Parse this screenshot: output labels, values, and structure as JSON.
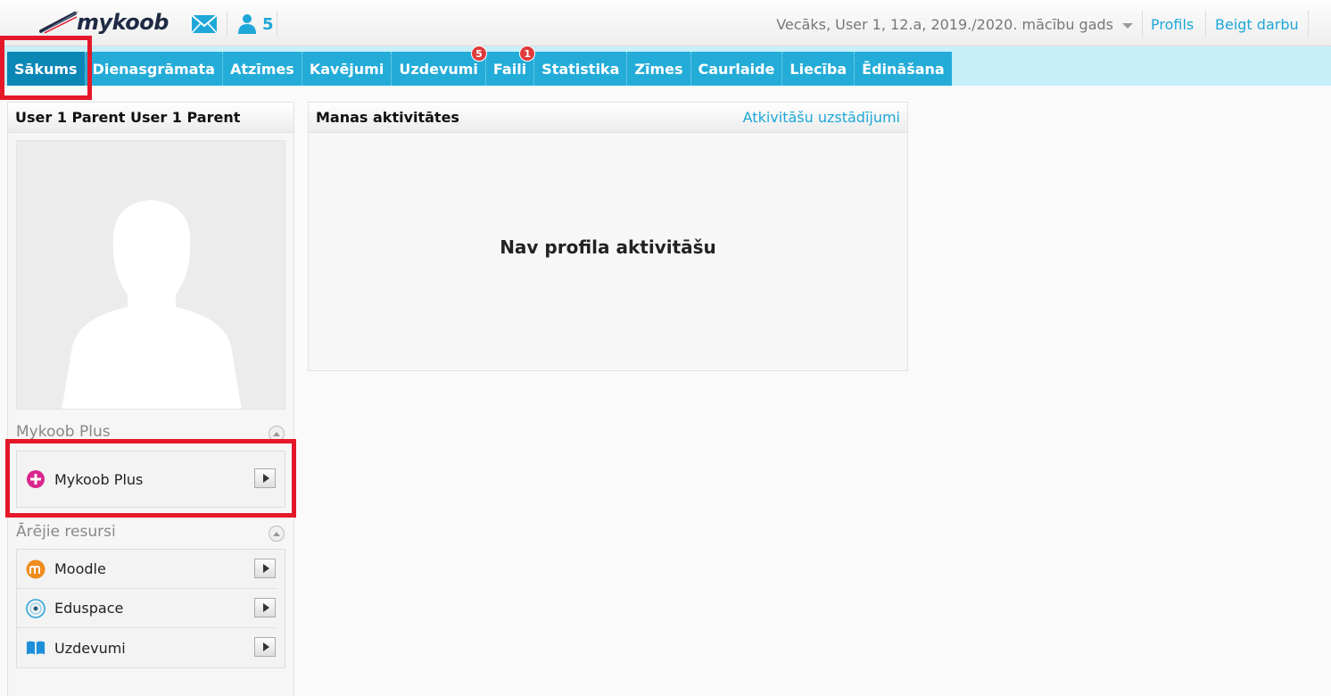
{
  "header": {
    "logo_text": "mykoob",
    "messages_icon": "envelope-icon",
    "users_icon": "users-icon",
    "users_count": "5",
    "role_selector": "Vecāks, User 1, 12.a, 2019./2020. mācību gads",
    "profile_link": "Profils",
    "logout_link": "Beigt darbu"
  },
  "nav": {
    "tabs": [
      {
        "label": "Sākums",
        "active": true
      },
      {
        "label": "Dienasgrāmata"
      },
      {
        "label": "Atzīmes"
      },
      {
        "label": "Kavējumi"
      },
      {
        "label": "Uzdevumi",
        "badge": "5"
      },
      {
        "label": "Faili",
        "badge": "1"
      },
      {
        "label": "Statistika"
      },
      {
        "label": "Zīmes"
      },
      {
        "label": "Caurlaide"
      },
      {
        "label": "Liecība"
      },
      {
        "label": "Ēdināšana"
      }
    ]
  },
  "profile": {
    "name": "User 1 Parent User 1 Parent",
    "plus_section_title": "Mykoob Plus",
    "plus_item_label": "Mykoob Plus",
    "plus_item_icon": "plus-circle-icon",
    "external_section_title": "Ārējie resursi",
    "external_items": [
      {
        "label": "Moodle",
        "icon": "moodle-icon"
      },
      {
        "label": "Eduspace",
        "icon": "eduspace-icon"
      },
      {
        "label": "Uzdevumi",
        "icon": "book-icon"
      }
    ]
  },
  "activities": {
    "title": "Manas aktivitātes",
    "settings_link": "Atkivitāšu uzstādījumi",
    "empty_text": "Nav profila aktivitāšu"
  },
  "colors": {
    "accent": "#24acd8",
    "active_tab": "#0b87b6",
    "highlight": "#e5182a",
    "badge": "#e03a3a"
  }
}
